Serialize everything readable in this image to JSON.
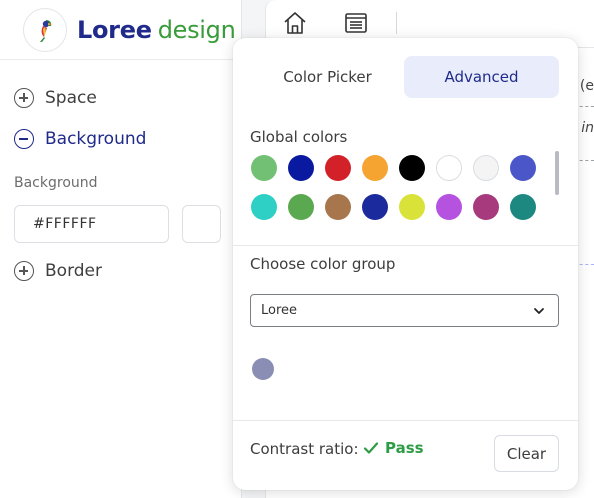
{
  "logo": {
    "word1": "Loree",
    "word2": "design"
  },
  "sidebar": {
    "items": [
      {
        "label": "Space",
        "state": "collapsed"
      },
      {
        "label": "Background",
        "state": "expanded"
      },
      {
        "label": "Border",
        "state": "collapsed"
      }
    ],
    "background_label": "Background",
    "hex_value": "#FFFFFF",
    "swatch_color": "#FFFFFF"
  },
  "toolbar": {
    "icons": [
      "home-icon",
      "layout-icon"
    ]
  },
  "canvas_edge": {
    "text1": "(e",
    "text2": "in"
  },
  "popover": {
    "tabs": [
      {
        "label": "Color Picker",
        "selected": false
      },
      {
        "label": "Advanced",
        "selected": true
      }
    ],
    "global_colors_title": "Global colors",
    "global_colors": [
      "#72c073",
      "#0a1aa0",
      "#d32129",
      "#f5a431",
      "#000000",
      "#ffffff",
      "#f4f4f4",
      "#4b57c9",
      "#2ed0c6",
      "#5aa950",
      "#a8764c",
      "#1b2a9c",
      "#d9e238",
      "#b553e0",
      "#a63a7c",
      "#1c8880"
    ],
    "group_title": "Choose color group",
    "group_value": "Loree",
    "group_colors": [
      "#8a8db4"
    ],
    "contrast_label": "Contrast ratio:",
    "contrast_result": "Pass",
    "clear_label": "Clear"
  }
}
